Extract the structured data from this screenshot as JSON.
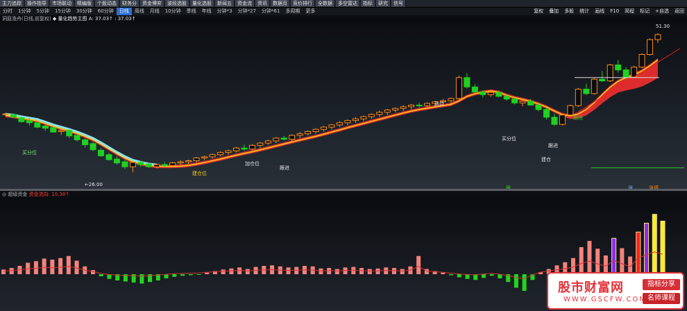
{
  "toolbar": {
    "buttons": [
      "主力追踪",
      "操作指导",
      "市场联动",
      "精编版",
      "个股动态",
      "财务分",
      "资金博弈",
      "波段选股",
      "量化选股",
      "新闻五",
      "资金流",
      "资讯",
      "数据页",
      "竞价排行",
      "全数据",
      "多空雷达",
      "指标",
      "研究",
      "信号"
    ]
  },
  "periods": {
    "items": [
      "分时",
      "1分钟",
      "5分钟",
      "15分钟",
      "30分钟",
      "60分钟",
      "日线",
      "周线",
      "月线",
      "10分钟",
      "季线",
      "年线",
      "分钟*3",
      "分钟*27",
      "分钟*61",
      "多周期",
      "更多"
    ],
    "active": "日线",
    "right": [
      "复权",
      "叠加",
      "多股",
      "统计",
      "画线",
      "F10",
      "简程",
      "标记",
      "+自选",
      "返回"
    ]
  },
  "infobar": {
    "text": "洞庭渔舟(日线,前复权)",
    "indicator": "◆ 量化趋势主图 A: 37.03↑ : 37.03↑"
  },
  "main_labels": {
    "price_high": "51.30",
    "price_low": "←26.00",
    "pos1": "买分位",
    "pos2": "建仓位",
    "pos3": "加仓位",
    "pos4": "跟进",
    "pos5": "高位",
    "pos6": "买分位",
    "pos7": "跟进",
    "pos8": "建仓",
    "pos9": "跟进",
    "buy1": "跟进",
    "buy2": "跟",
    "buy3": "涨停",
    "buy4": "涨"
  },
  "sub_header": {
    "title": "◎ 超级资金",
    "warn": "资金流向: 10.38↑"
  },
  "watermark": {
    "title": "股市财富网",
    "url": "WWW.GSCFW.COM",
    "tag1": "指标分享",
    "tag2": "名师课程"
  },
  "colors": {
    "up": "#ff8c1a",
    "down": "#20d020",
    "upbar": "#f4837b",
    "downbar": "#21d61c",
    "yellow": "#f7f01a",
    "purple": "#8a2cf0",
    "red": "#ff1e1e"
  },
  "chart_data": {
    "type": "candlestick",
    "candles": [
      [
        36.6,
        36.8,
        36.2,
        36.6
      ],
      [
        36.5,
        36.7,
        35.8,
        36.0
      ],
      [
        35.9,
        36.1,
        35.0,
        35.2
      ],
      [
        35.4,
        35.8,
        34.5,
        35.0
      ],
      [
        35.0,
        35.3,
        34.0,
        34.2
      ],
      [
        34.4,
        34.8,
        33.5,
        34.0
      ],
      [
        34.1,
        34.3,
        33.2,
        33.3
      ],
      [
        33.4,
        33.9,
        32.8,
        33.6
      ],
      [
        33.6,
        33.8,
        32.2,
        32.6
      ],
      [
        32.7,
        33.0,
        31.6,
        31.9
      ],
      [
        31.9,
        32.2,
        30.5,
        31.0
      ],
      [
        31.2,
        31.6,
        29.8,
        30.1
      ],
      [
        30.0,
        30.4,
        28.8,
        29.0
      ],
      [
        29.2,
        29.5,
        28.1,
        28.3
      ],
      [
        28.4,
        28.9,
        27.4,
        27.7
      ],
      [
        27.9,
        28.3,
        26.6,
        27.0
      ],
      [
        27.0,
        28.0,
        26.0,
        27.8
      ],
      [
        27.8,
        28.1,
        27.0,
        27.4
      ],
      [
        27.5,
        27.7,
        26.8,
        27.0
      ],
      [
        27.0,
        27.6,
        26.7,
        27.4
      ],
      [
        27.4,
        27.8,
        27.0,
        27.2
      ],
      [
        27.2,
        27.9,
        27.0,
        27.7
      ],
      [
        27.7,
        28.2,
        27.3,
        27.9
      ],
      [
        27.9,
        28.3,
        27.5,
        28.1
      ],
      [
        28.1,
        28.8,
        27.8,
        28.6
      ],
      [
        28.6,
        29.0,
        28.2,
        28.8
      ],
      [
        28.8,
        29.4,
        28.5,
        29.2
      ],
      [
        29.2,
        29.8,
        28.9,
        29.6
      ],
      [
        29.6,
        30.1,
        29.2,
        29.9
      ],
      [
        29.9,
        30.6,
        29.6,
        30.4
      ],
      [
        30.4,
        31.0,
        29.9,
        30.2
      ],
      [
        30.2,
        31.1,
        30.0,
        30.9
      ],
      [
        30.9,
        31.5,
        30.4,
        31.3
      ],
      [
        31.3,
        31.9,
        31.0,
        31.7
      ],
      [
        31.7,
        32.4,
        31.3,
        32.2
      ],
      [
        32.2,
        32.6,
        31.8,
        32.0
      ],
      [
        32.0,
        32.9,
        31.7,
        32.7
      ],
      [
        32.7,
        33.3,
        32.2,
        33.0
      ],
      [
        33.0,
        33.6,
        32.7,
        33.4
      ],
      [
        33.4,
        34.0,
        33.0,
        33.8
      ],
      [
        33.8,
        34.4,
        33.4,
        34.2
      ],
      [
        34.2,
        34.8,
        33.8,
        34.6
      ],
      [
        34.6,
        35.3,
        34.2,
        35.0
      ],
      [
        35.0,
        35.6,
        34.5,
        35.4
      ],
      [
        35.4,
        36.0,
        35.0,
        35.7
      ],
      [
        35.7,
        36.3,
        35.3,
        36.1
      ],
      [
        36.1,
        36.7,
        35.7,
        36.5
      ],
      [
        36.5,
        37.2,
        36.1,
        36.9
      ],
      [
        36.9,
        37.5,
        36.4,
        37.3
      ],
      [
        37.3,
        37.8,
        36.9,
        37.6
      ],
      [
        37.6,
        38.2,
        37.1,
        37.9
      ],
      [
        37.9,
        38.4,
        37.4,
        38.2
      ],
      [
        38.2,
        38.6,
        37.8,
        38.1
      ],
      [
        38.1,
        38.7,
        37.7,
        38.5
      ],
      [
        38.5,
        39.0,
        38.0,
        38.8
      ],
      [
        38.8,
        39.3,
        38.3,
        39.0
      ],
      [
        39.0,
        39.6,
        38.5,
        39.4
      ],
      [
        39.4,
        43.6,
        39.0,
        43.2
      ],
      [
        43.2,
        44.0,
        41.2,
        41.5
      ],
      [
        41.5,
        42.0,
        40.3,
        40.6
      ],
      [
        40.6,
        40.9,
        39.6,
        40.1
      ],
      [
        40.1,
        40.8,
        39.7,
        40.5
      ],
      [
        40.5,
        40.8,
        39.6,
        39.8
      ],
      [
        39.8,
        40.2,
        39.0,
        39.3
      ],
      [
        39.3,
        39.6,
        38.3,
        38.6
      ],
      [
        38.6,
        39.1,
        38.0,
        38.9
      ],
      [
        38.9,
        39.3,
        38.1,
        38.2
      ],
      [
        38.2,
        38.6,
        37.1,
        37.4
      ],
      [
        37.4,
        37.8,
        35.6,
        36.0
      ],
      [
        36.0,
        36.6,
        34.4,
        34.7
      ],
      [
        34.7,
        36.6,
        34.5,
        36.4
      ],
      [
        36.4,
        38.3,
        36.2,
        38.1
      ],
      [
        38.1,
        41.3,
        37.9,
        41.1
      ],
      [
        41.1,
        42.1,
        40.0,
        40.3
      ],
      [
        40.3,
        43.1,
        40.1,
        42.9
      ],
      [
        42.9,
        44.4,
        42.4,
        42.6
      ],
      [
        42.6,
        45.7,
        42.4,
        45.5
      ],
      [
        45.5,
        46.4,
        44.1,
        44.6
      ],
      [
        44.6,
        45.1,
        43.0,
        43.3
      ],
      [
        43.3,
        45.3,
        43.1,
        45.1
      ],
      [
        45.1,
        47.6,
        44.9,
        47.4
      ],
      [
        47.4,
        50.3,
        47.2,
        50.1
      ],
      [
        50.1,
        51.3,
        49.5,
        51.0
      ]
    ],
    "macd": [
      0.9,
      1.2,
      1.6,
      2.2,
      2.5,
      3.0,
      2.8,
      3.1,
      3.5,
      2.6,
      1.5,
      0.8,
      -0.4,
      -0.9,
      -1.2,
      -1.4,
      -1.6,
      -1.8,
      -1.5,
      -1.2,
      -0.8,
      -0.5,
      -0.3,
      -0.2,
      -0.1,
      0.3,
      0.6,
      0.9,
      1.1,
      1.3,
      1.0,
      1.4,
      1.6,
      1.7,
      1.5,
      1.3,
      1.4,
      1.6,
      1.5,
      1.1,
      1.2,
      1.0,
      1.3,
      1.4,
      1.2,
      1.0,
      1.1,
      1.3,
      1.2,
      1.0,
      1.5,
      3.5,
      1.0,
      0.6,
      0.3,
      -0.2,
      -0.6,
      -0.9,
      -1.1,
      -0.7,
      -0.3,
      -0.8,
      -1.5,
      -2.6,
      -3.2,
      -1.1,
      0.4,
      1.0,
      1.7,
      2.3,
      3.1,
      5.2,
      6.4,
      4.9,
      3.6,
      6.9,
      5.0,
      3.4,
      8.1,
      9.8,
      11.5,
      10.2
    ]
  }
}
